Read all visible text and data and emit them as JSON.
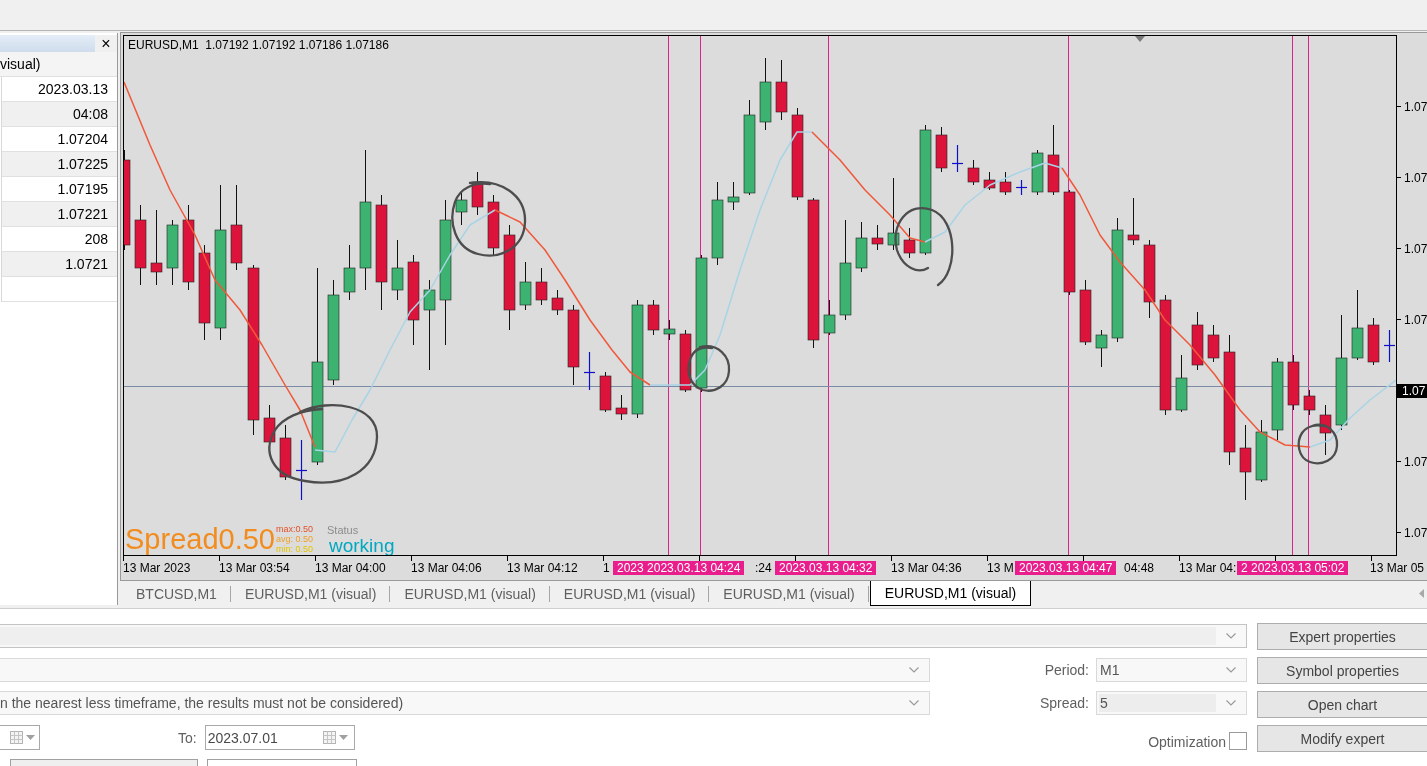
{
  "data_window": {
    "close": "×",
    "title": "visual)",
    "rows": [
      {
        "value": "2023.03.13"
      },
      {
        "value": "04:08"
      },
      {
        "value": "1.07204"
      },
      {
        "value": "1.07225"
      },
      {
        "value": "1.07195"
      },
      {
        "value": "1.07221"
      },
      {
        "value": "208"
      },
      {
        "value": "1.0721"
      }
    ]
  },
  "chart": {
    "header": "EURUSD,M1  1.07192 1.07192 1.07186 1.07186",
    "spread": {
      "label": "Spread",
      "value": "0.50",
      "max": "max:0.50",
      "avg": "avg: 0.50",
      "min": "min: 0.50"
    },
    "status": {
      "label": "Status",
      "value": "working"
    },
    "price_labels": [
      {
        "text": "1.07",
        "current": false
      },
      {
        "text": "1.07",
        "current": false
      },
      {
        "text": "1.07",
        "current": false
      },
      {
        "text": "1.07",
        "current": false
      },
      {
        "text": "1.07",
        "current": true
      },
      {
        "text": "1.07",
        "current": false
      },
      {
        "text": "1.07",
        "current": false
      }
    ],
    "time_labels": [
      {
        "text": "13 Mar 2023",
        "kind": "tick"
      },
      {
        "text": "13 Mar 03:54",
        "kind": "tick"
      },
      {
        "text": "13 Mar 04:00",
        "kind": "tick"
      },
      {
        "text": "13 Mar 04:06",
        "kind": "tick"
      },
      {
        "text": "13 Mar 04:12",
        "kind": "tick"
      },
      {
        "text": "1",
        "kind": "tick"
      },
      {
        "text": "2023 2023.03.13 04:24",
        "kind": "marker"
      },
      {
        "text": ":24",
        "kind": "tick"
      },
      {
        "text": "2023.03.13 04:32",
        "kind": "marker"
      },
      {
        "text": "13 Mar 04:36",
        "kind": "tick"
      },
      {
        "text": "13 M",
        "kind": "tick"
      },
      {
        "text": "2023.03.13 04:47",
        "kind": "marker"
      },
      {
        "text": "04:48",
        "kind": "tick"
      },
      {
        "text": "13 Mar 04:",
        "kind": "tick"
      },
      {
        "text": "2 2023.03.13 05:02",
        "kind": "marker"
      },
      {
        "text": "13 Mar 05",
        "kind": "tick"
      }
    ]
  },
  "chart_tabs": [
    {
      "label": "BTCUSD,M1",
      "selected": false
    },
    {
      "label": "EURUSD,M1 (visual)",
      "selected": false
    },
    {
      "label": "EURUSD,M1 (visual)",
      "selected": false
    },
    {
      "label": "EURUSD,M1 (visual)",
      "selected": false
    },
    {
      "label": "EURUSD,M1 (visual)",
      "selected": false
    },
    {
      "label": "EURUSD,M1 (visual)",
      "selected": true
    }
  ],
  "tester": {
    "model_note": "n the nearest less timeframe, the results must not be considered)",
    "period": {
      "label": "Period:",
      "value": "M1"
    },
    "spread": {
      "label": "Spread:",
      "value": "5"
    },
    "to_date": {
      "label": "To:",
      "value": "2023.07.01"
    },
    "optimization": {
      "label": "Optimization",
      "checked": false
    },
    "buttons": [
      "Expert properties",
      "Symbol properties",
      "Open chart",
      "Modify expert"
    ]
  }
}
